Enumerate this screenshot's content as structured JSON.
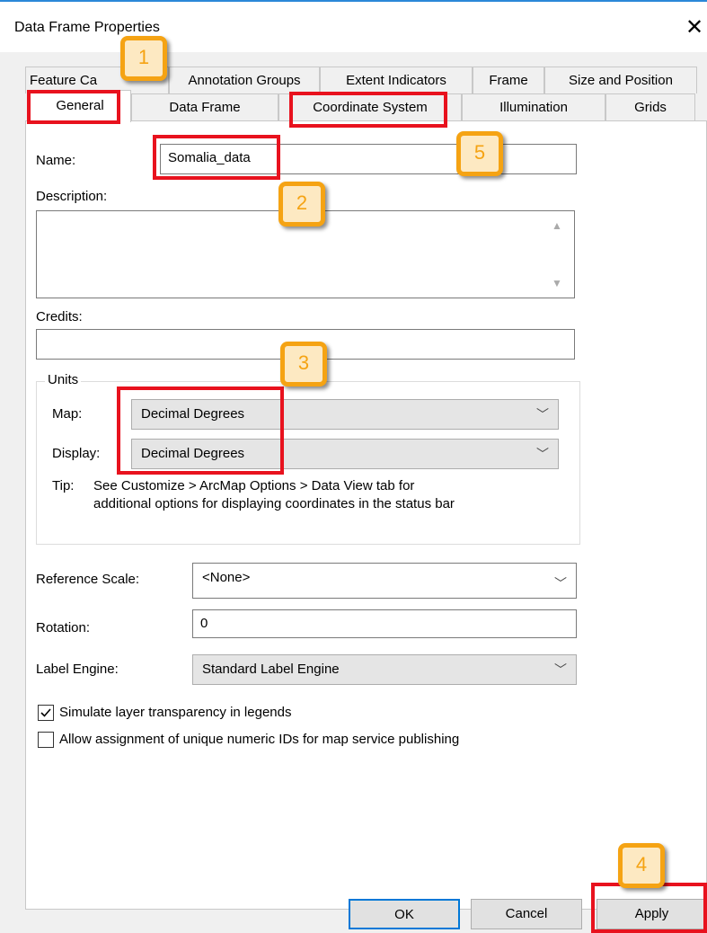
{
  "window": {
    "title": "Data Frame Properties",
    "close_symbol": "✕"
  },
  "tabs_back": [
    "Feature Ca",
    "Annotation Groups",
    "Extent Indicators",
    "Frame",
    "Size and Position"
  ],
  "tabs_front": [
    "General",
    "Data Frame",
    "Coordinate System",
    "Illumination",
    "Grids"
  ],
  "general": {
    "name_label": "Name:",
    "name_value": "Somalia_data",
    "description_label": "Description:",
    "description_value": "",
    "credits_label": "Credits:",
    "credits_value": "",
    "units": {
      "group_label": "Units",
      "map_label": "Map:",
      "map_value": "Decimal Degrees",
      "display_label": "Display:",
      "display_value": "Decimal Degrees",
      "tip_label": "Tip:",
      "tip_line1": "See Customize > ArcMap Options > Data View tab for",
      "tip_line2": "additional options for displaying coordinates in the status bar"
    },
    "reference_scale_label": "Reference Scale:",
    "reference_scale_value": "<None>",
    "rotation_label": "Rotation:",
    "rotation_value": "0",
    "label_engine_label": "Label Engine:",
    "label_engine_value": "Standard Label Engine",
    "simulate_transparency_label": "Simulate layer transparency in legends",
    "simulate_transparency_checked": true,
    "unique_ids_label": "Allow assignment of unique numeric IDs for map service publishing",
    "unique_ids_checked": false
  },
  "buttons": {
    "ok": "OK",
    "cancel": "Cancel",
    "apply": "Apply"
  },
  "callouts": [
    "1",
    "2",
    "3",
    "4",
    "5"
  ],
  "colors": {
    "highlight_red": "#e8121e",
    "callout_orange": "#f5a313",
    "callout_fill": "#fde9c2",
    "accent_blue": "#0078d7"
  }
}
